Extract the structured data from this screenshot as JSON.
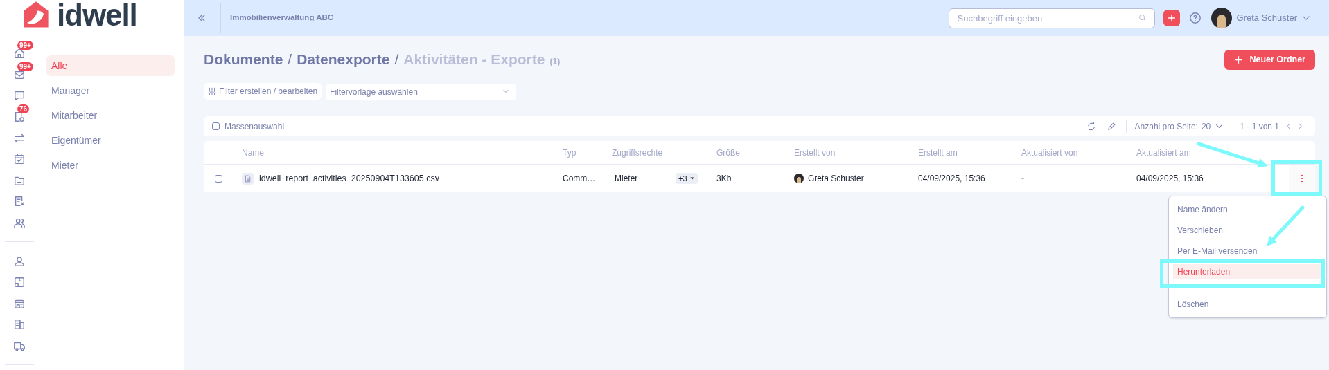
{
  "logo": {
    "text": "idwell"
  },
  "rail": {
    "badges": [
      "99+",
      "99+",
      "76"
    ]
  },
  "subnav": {
    "items": [
      {
        "label": "Alle",
        "selected": true
      },
      {
        "label": "Manager",
        "selected": false
      },
      {
        "label": "Mitarbeiter",
        "selected": false
      },
      {
        "label": "Eigentümer",
        "selected": false
      },
      {
        "label": "Mieter",
        "selected": false
      }
    ]
  },
  "topbar": {
    "title": "Immobilienverwaltung ABC",
    "search": {
      "placeholder": "Suchbegriff eingeben"
    },
    "user": {
      "name": "Greta Schuster"
    }
  },
  "breadcrumb": {
    "parts": [
      {
        "kind": "link",
        "text": "Dokumente"
      },
      {
        "kind": "separator",
        "text": "/"
      },
      {
        "kind": "link",
        "text": "Datenexporte"
      },
      {
        "kind": "separator",
        "text": "/"
      }
    ],
    "current": "Aktivitäten - Exporte",
    "count": "(1)"
  },
  "new_folder_button": "Neuer Ordner",
  "filters": {
    "edit_button": "Filter erstellen / bearbeiten",
    "template_select": {
      "placeholder": "Filtervorlage auswählen"
    }
  },
  "toolbar": {
    "bulk_select": {
      "label": "Massenauswahl",
      "checked": false
    },
    "per_page_label": "Anzahl pro Seite:",
    "per_page": "20",
    "pagination": "1 - 1 von 1"
  },
  "table": {
    "columns": [
      "Name",
      "Typ",
      "Zugriffsrechte",
      "Größe",
      "Erstellt von",
      "Erstellt am",
      "Aktualisiert von",
      "Aktualisiert am"
    ],
    "rows": [
      {
        "checked": false,
        "name": "idwell_report_activities_20250904T133605.csv",
        "type": "Comm…",
        "access": "Mieter",
        "access_more": "+3",
        "size": "3Kb",
        "created_by": "Greta Schuster",
        "created_at": "04/09/2025, 15:36",
        "updated_by": "-",
        "updated_at": "04/09/2025, 15:36"
      }
    ]
  },
  "context_menu": {
    "items": [
      {
        "label": "Name ändern",
        "selected": false
      },
      {
        "label": "Verschieben",
        "selected": false
      },
      {
        "label": "Per E-Mail versenden",
        "selected": false
      },
      {
        "label": "Herunterladen",
        "selected": true
      },
      {
        "label": "Löschen",
        "selected": false,
        "divider_before": true
      }
    ]
  },
  "annotations": [
    {
      "kind": "arrow"
    },
    {
      "kind": "box"
    },
    {
      "kind": "arrow"
    },
    {
      "kind": "box"
    }
  ]
}
